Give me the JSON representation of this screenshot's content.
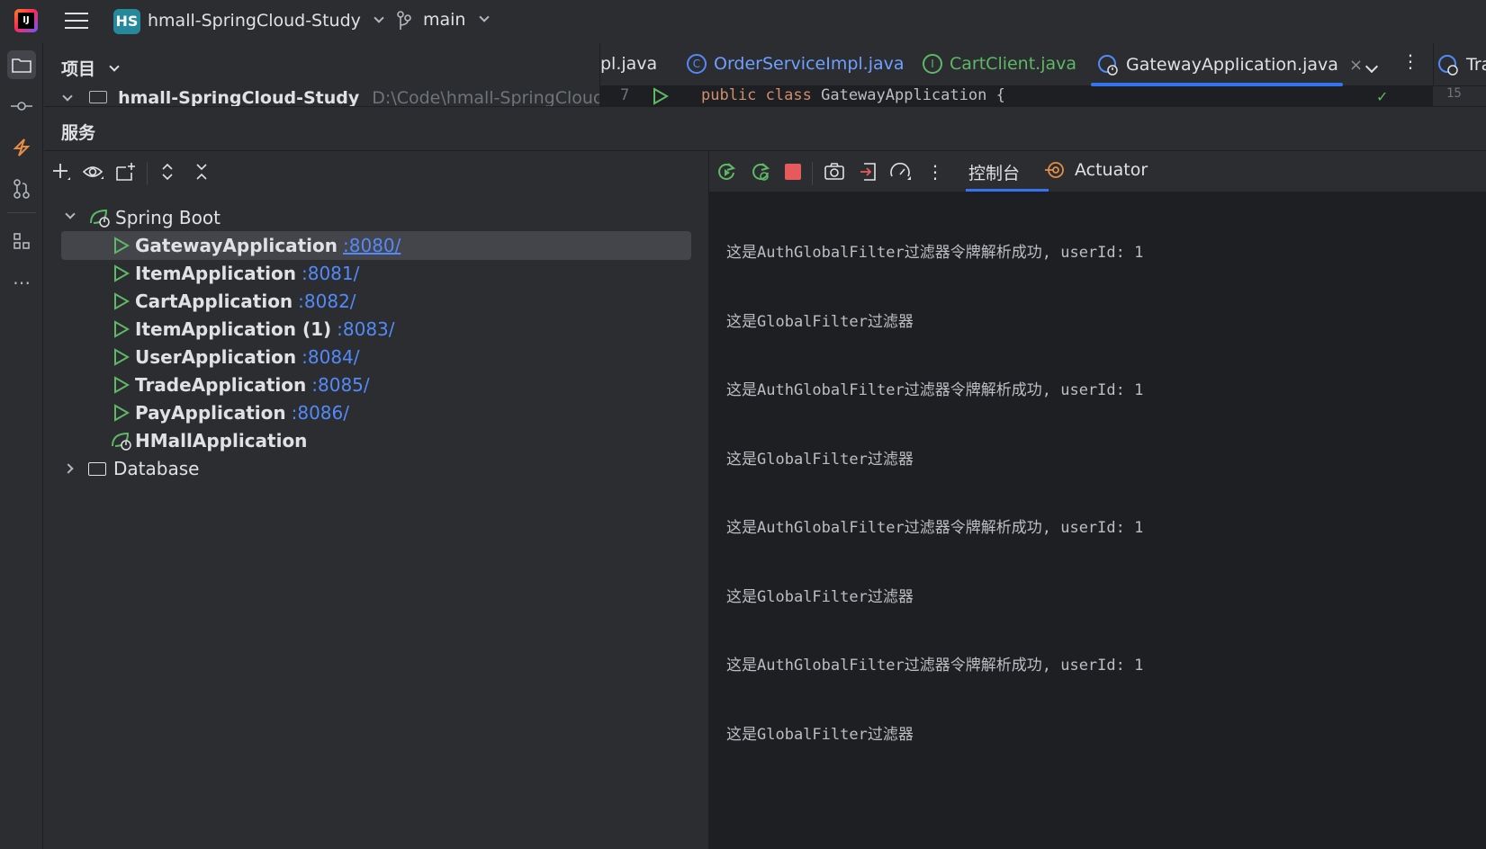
{
  "titlebar": {
    "project_badge": "HS",
    "project_name": "hmall-SpringCloud-Study",
    "branch": "main"
  },
  "project_panel": {
    "title": "项目",
    "root_name": "hmall-SpringCloud-Study",
    "root_path": "D:\\Code\\hmall-SpringCloud-Stu"
  },
  "editor": {
    "tabs": [
      {
        "label": "pl.java",
        "active": false
      },
      {
        "label": "OrderServiceImpl.java",
        "active": false
      },
      {
        "label": "CartClient.java",
        "active": false
      },
      {
        "label": "GatewayApplication.java",
        "active": true
      },
      {
        "label": "Tra",
        "active": false
      }
    ],
    "line_number": "7",
    "code_kw1": "public",
    "code_kw2": "class",
    "code_rest": "GatewayApplication {",
    "right_gutter_num": "15"
  },
  "services": {
    "title": "服务",
    "group": "Spring Boot",
    "apps": [
      {
        "name": "GatewayApplication",
        "port": ":8080/",
        "selected": true
      },
      {
        "name": "ItemApplication",
        "port": ":8081/"
      },
      {
        "name": "CartApplication",
        "port": ":8082/"
      },
      {
        "name": "ItemApplication (1)",
        "port": ":8083/"
      },
      {
        "name": "UserApplication",
        "port": ":8084/"
      },
      {
        "name": "TradeApplication",
        "port": ":8085/"
      },
      {
        "name": "PayApplication",
        "port": ":8086/"
      },
      {
        "name": "HMallApplication",
        "port": ""
      }
    ],
    "database": "Database"
  },
  "console": {
    "tab_console": "控制台",
    "tab_actuator": "Actuator",
    "lines": [
      "这是AuthGlobalFilter过滤器令牌解析成功, userId: 1",
      "这是GlobalFilter过滤器",
      "这是AuthGlobalFilter过滤器令牌解析成功, userId: 1",
      "这是GlobalFilter过滤器",
      "这是AuthGlobalFilter过滤器令牌解析成功, userId: 1",
      "这是GlobalFilter过滤器",
      "这是AuthGlobalFilter过滤器令牌解析成功, userId: 1",
      "这是GlobalFilter过滤器"
    ]
  },
  "colors": {
    "accent": "#3574f0",
    "link": "#548af7",
    "run_green": "#5fb865",
    "stop_red": "#e55b5b"
  }
}
